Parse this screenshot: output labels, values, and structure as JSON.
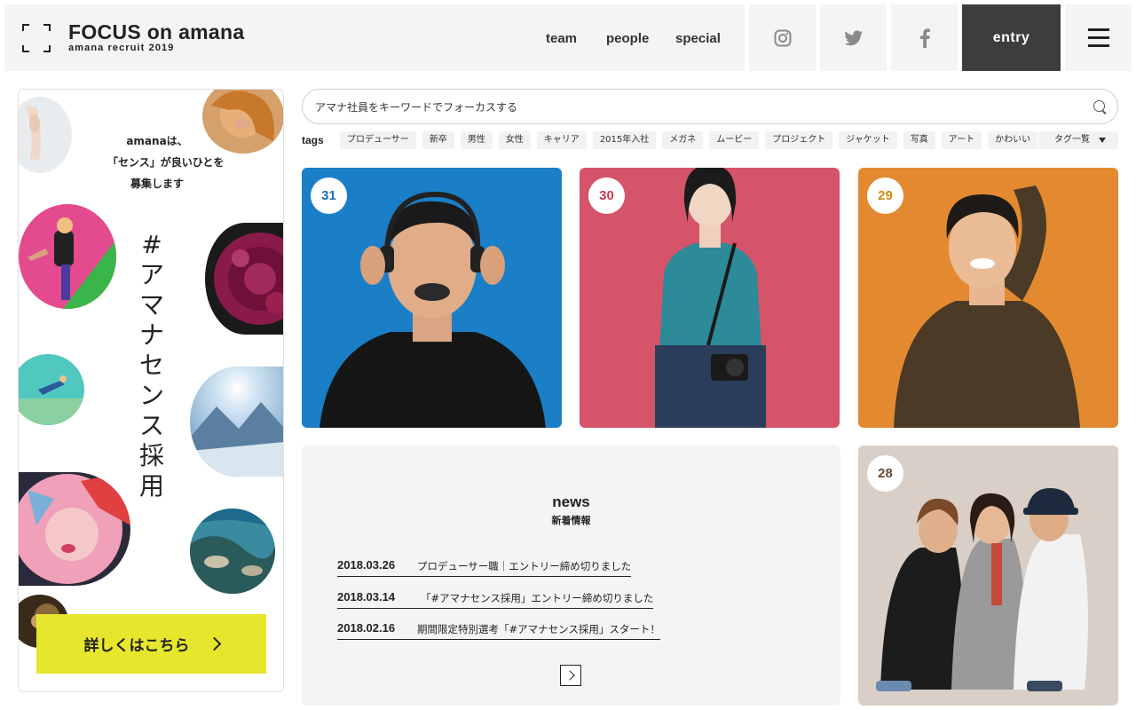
{
  "header": {
    "title": "FOCUS on amana",
    "subtitle": "amana recruit 2019",
    "nav": [
      "team",
      "people",
      "special"
    ],
    "social": [
      "instagram-icon",
      "twitter-icon",
      "facebook-icon"
    ],
    "entry_label": "entry",
    "menu_icon": "hamburger-menu-icon"
  },
  "promo": {
    "lines": [
      "amanaは、",
      "「センス」が良いひとを",
      "募集します"
    ],
    "vertical_title": [
      "#",
      "ア",
      "マ",
      "ナ",
      "セ",
      "ン",
      "ス",
      "採",
      "用"
    ],
    "button_label": "詳しくはこちら"
  },
  "search": {
    "placeholder": "アマナ社員をキーワードでフォーカスする"
  },
  "tags": {
    "label": "tags",
    "items": [
      "プロデューサー",
      "新卒",
      "男性",
      "女性",
      "キャリア",
      "2015年入社",
      "メガネ",
      "ムービー",
      "プロジェクト",
      "ジャケット",
      "写真",
      "アート",
      "かわいい"
    ],
    "list_label": "タグ一覧"
  },
  "people": [
    {
      "number": "31",
      "bg": "#1a7fc6",
      "accent": "#1b6fae"
    },
    {
      "number": "30",
      "bg": "#d5546a",
      "accent": "#c9385b"
    },
    {
      "number": "29",
      "bg": "#e38a30",
      "accent": "#d28a12"
    },
    {
      "number": "28",
      "bg": "#d9cfc6",
      "accent": "#6b4b36"
    }
  ],
  "news": {
    "title": "news",
    "subtitle": "新着情報",
    "items": [
      {
        "date": "2018.03.26",
        "text": "プロデューサー職｜エントリー締め切りました"
      },
      {
        "date": "2018.03.14",
        "text": "「#アマナセンス採用」エントリー締め切りました"
      },
      {
        "date": "2018.02.16",
        "text": "期間限定特別選考「#アマナセンス採用」スタート！"
      }
    ]
  }
}
